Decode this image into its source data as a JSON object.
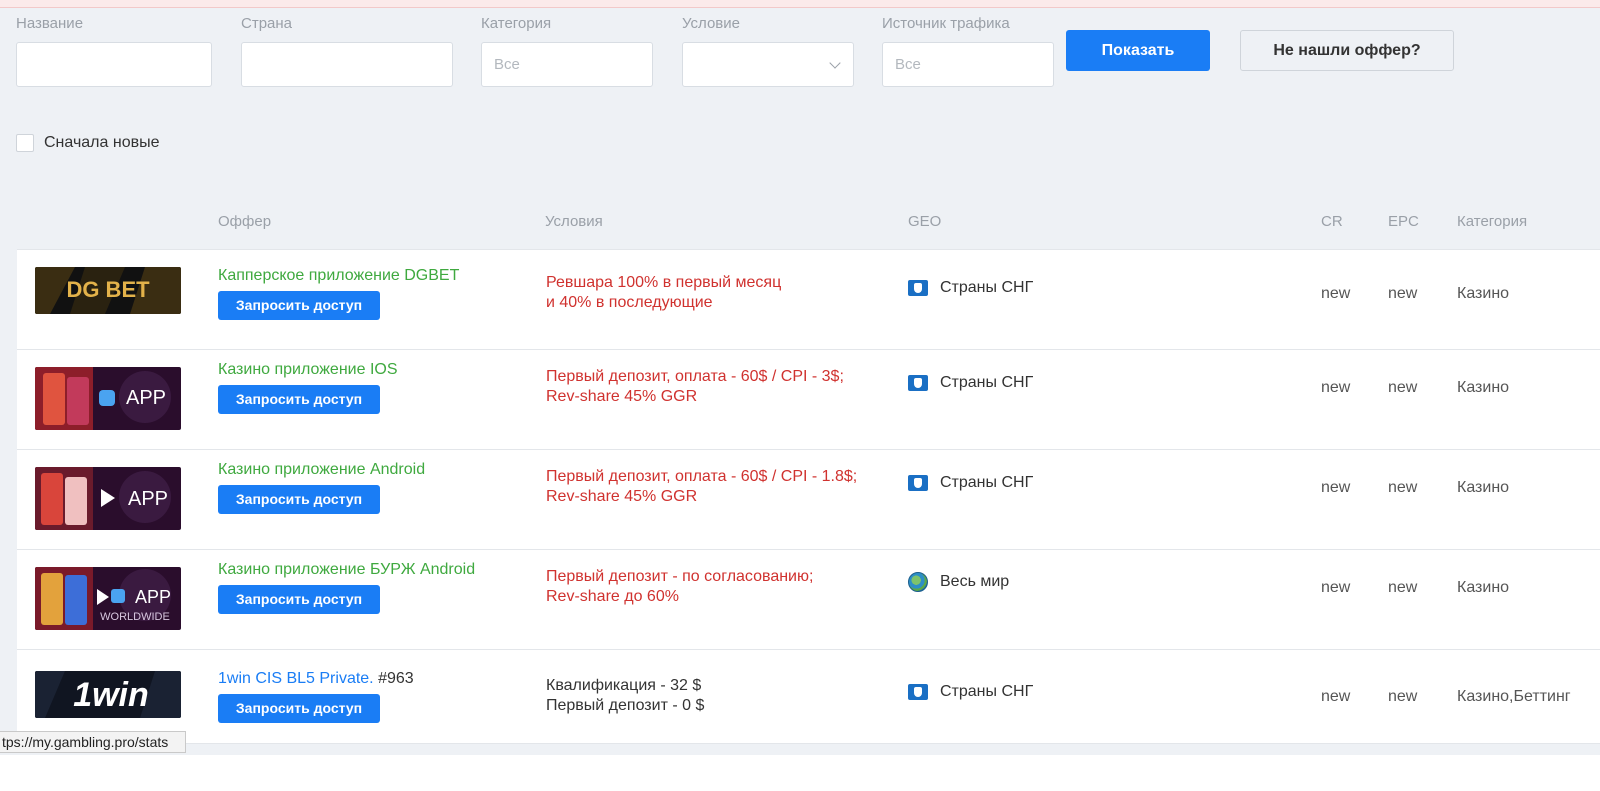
{
  "filters": {
    "name_label": "Название",
    "country_label": "Страна",
    "category_label": "Категория",
    "category_placeholder": "Все",
    "condition_label": "Условие",
    "traffic_label": "Источник трафика",
    "traffic_placeholder": "Все",
    "show_button": "Показать",
    "not_found_button": "Не нашли оффер?",
    "newest_first_label": "Сначала новые"
  },
  "table": {
    "headers": {
      "offer": "Оффер",
      "conditions": "Условия",
      "geo": "GEO",
      "cr": "CR",
      "epc": "EPC",
      "category": "Категория"
    },
    "request_access_label": "Запросить доступ",
    "rows": [
      {
        "thumb_icon": "dgbet-logo",
        "thumb_text": "DG BET",
        "name": "Капперское приложение DGBET",
        "cond_line1": "Ревшара 100% в первый месяц",
        "cond_line2": "и 40% в последующие",
        "geo": "Страны СНГ",
        "cr": "new",
        "epc": "new",
        "category": "Казино"
      },
      {
        "thumb_icon": "app-store-banner",
        "thumb_text": "APP",
        "name": "Казино приложение IOS",
        "cond_line1": "Первый депозит, оплата - 60$ / CPI - 3$;",
        "cond_line2": "Rev-share 45% GGR",
        "geo": "Страны СНГ",
        "cr": "new",
        "epc": "new",
        "category": "Казино"
      },
      {
        "thumb_icon": "google-play-banner",
        "thumb_text": "APP",
        "name": "Казино приложение Android",
        "cond_line1": "Первый депозит, оплата - 60$ / CPI - 1.8$;",
        "cond_line2": "Rev-share 45% GGR",
        "geo": "Страны СНГ",
        "cr": "new",
        "epc": "new",
        "category": "Казино"
      },
      {
        "thumb_icon": "worldwide-app-banner",
        "thumb_text": "APP",
        "thumb_subtext": "WORLDWIDE",
        "name": "Казино приложение БУРЖ Android",
        "cond_line1": "Первый депозит - по согласованию;",
        "cond_line2": "Rev-share до 60%",
        "geo": "Весь мир",
        "cr": "new",
        "epc": "new",
        "category": "Казино"
      },
      {
        "thumb_icon": "1win-logo",
        "thumb_text": "1win",
        "name": "1win CIS BL5 Private.",
        "number": "#963",
        "cond_line1": "Квалификация - 32 $",
        "cond_line2": "Первый депозит - 0 $",
        "geo": "Страны СНГ",
        "cr": "new",
        "epc": "new",
        "category": "Казино,Беттинг"
      }
    ]
  },
  "status_bar_url": "tps://my.gambling.pro/stats",
  "colors": {
    "accent": "#1a7df5",
    "offer_green": "#3fa93f",
    "condition_red": "#d0322f",
    "background": "#eef1f5"
  }
}
